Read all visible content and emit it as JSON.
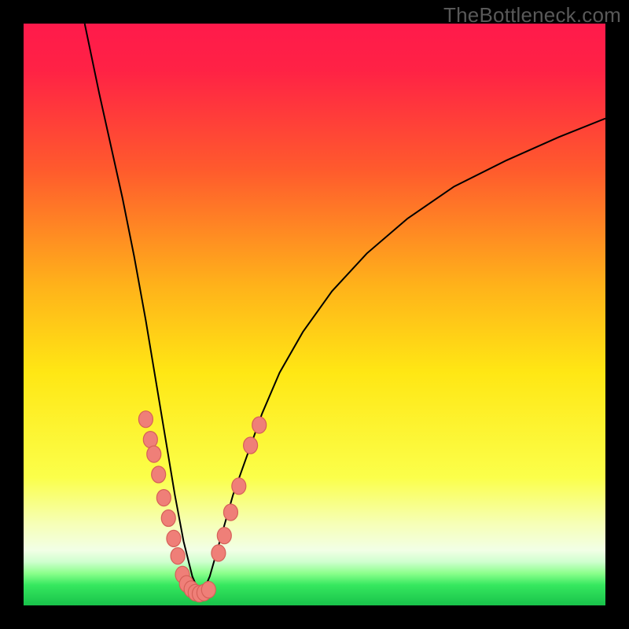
{
  "watermark": "TheBottleneck.com",
  "colors": {
    "gradient_stops": [
      {
        "pos": 0.0,
        "color": "#ff1a4b"
      },
      {
        "pos": 0.08,
        "color": "#ff2245"
      },
      {
        "pos": 0.25,
        "color": "#ff5a2d"
      },
      {
        "pos": 0.45,
        "color": "#ffb21a"
      },
      {
        "pos": 0.6,
        "color": "#ffe714"
      },
      {
        "pos": 0.78,
        "color": "#fbff4a"
      },
      {
        "pos": 0.86,
        "color": "#f6ffb7"
      },
      {
        "pos": 0.905,
        "color": "#f2ffe6"
      },
      {
        "pos": 0.925,
        "color": "#cfffcf"
      },
      {
        "pos": 0.945,
        "color": "#8bff8b"
      },
      {
        "pos": 0.965,
        "color": "#36e85f"
      },
      {
        "pos": 1.0,
        "color": "#18c24a"
      }
    ],
    "marker_fill": "#ef7f78",
    "marker_stroke": "#d66058",
    "curve": "#000000",
    "frame": "#000000"
  },
  "chart_data": {
    "type": "line",
    "title": "",
    "xlabel": "",
    "ylabel": "",
    "xlim": [
      0,
      100
    ],
    "ylim": [
      0,
      100
    ],
    "notes": "V-shaped bottleneck curve. Left branch descends steeply from top-left to a minimum near x≈27–30; right branch rises with decreasing slope toward top-right. Pink markers cluster along both branches near the valley bottom (roughly y between 0 and 30).",
    "series": [
      {
        "name": "left-branch",
        "x": [
          10.5,
          13,
          15,
          17,
          19,
          21,
          23,
          24.5,
          26,
          27.5,
          29,
          30.5
        ],
        "y": [
          100,
          88,
          79,
          70,
          60,
          49,
          37,
          28,
          19,
          11,
          5,
          1.5
        ]
      },
      {
        "name": "right-branch",
        "x": [
          30.5,
          32,
          34,
          36,
          38.5,
          41,
          44,
          48,
          53,
          59,
          66,
          74,
          83,
          92,
          100
        ],
        "y": [
          1.5,
          5,
          12,
          19,
          26,
          33,
          40,
          47,
          54,
          60.5,
          66.5,
          72,
          76.5,
          80.5,
          83.7
        ]
      }
    ],
    "markers": [
      {
        "x": 21.0,
        "y": 32.0
      },
      {
        "x": 21.8,
        "y": 28.5
      },
      {
        "x": 22.4,
        "y": 26.0
      },
      {
        "x": 23.2,
        "y": 22.5
      },
      {
        "x": 24.1,
        "y": 18.5
      },
      {
        "x": 24.9,
        "y": 15.0
      },
      {
        "x": 25.8,
        "y": 11.5
      },
      {
        "x": 26.5,
        "y": 8.5
      },
      {
        "x": 27.3,
        "y": 5.3
      },
      {
        "x": 28.0,
        "y": 3.7
      },
      {
        "x": 28.8,
        "y": 2.8
      },
      {
        "x": 29.5,
        "y": 2.2
      },
      {
        "x": 30.2,
        "y": 2.0
      },
      {
        "x": 31.0,
        "y": 2.2
      },
      {
        "x": 31.8,
        "y": 2.7
      },
      {
        "x": 33.5,
        "y": 9.0
      },
      {
        "x": 34.5,
        "y": 12.0
      },
      {
        "x": 35.6,
        "y": 16.0
      },
      {
        "x": 37.0,
        "y": 20.5
      },
      {
        "x": 39.0,
        "y": 27.5
      },
      {
        "x": 40.5,
        "y": 31.0
      }
    ]
  }
}
